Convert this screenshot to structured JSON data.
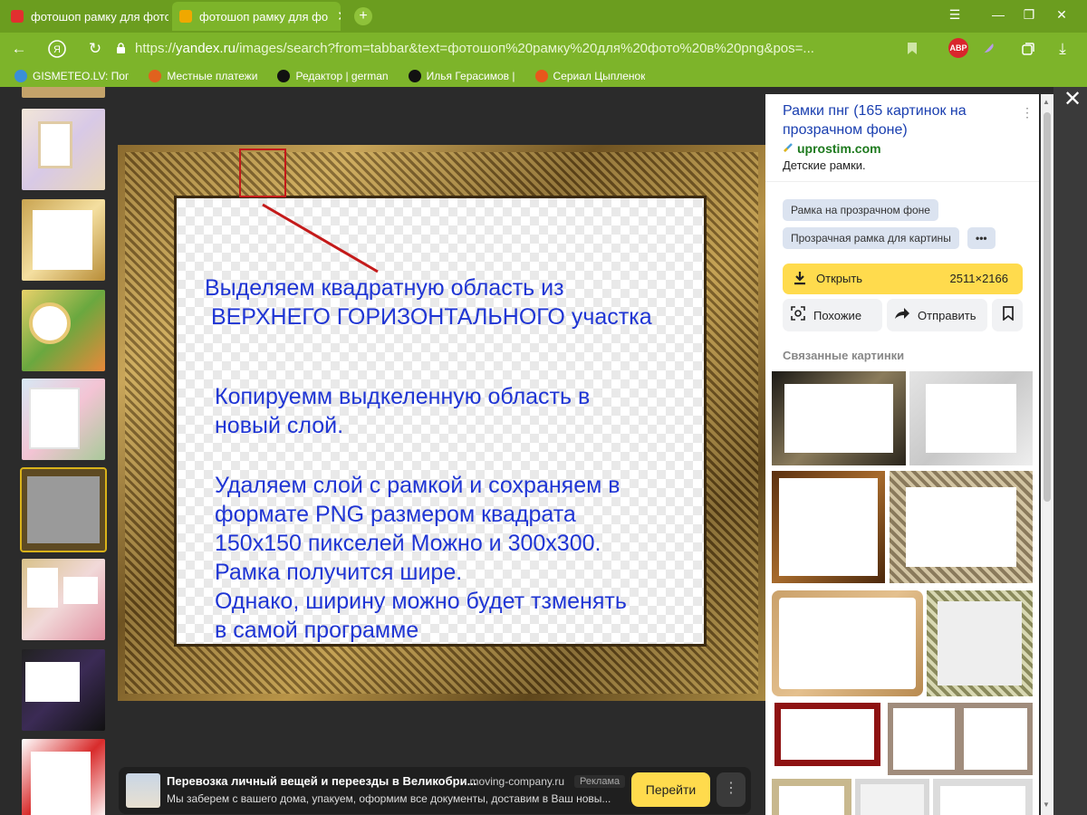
{
  "browser": {
    "tabs": [
      {
        "title": "фотошоп рамку для фото",
        "favicon_color": "#e22f2f"
      },
      {
        "title": "фотошоп рамку для фо",
        "favicon_color": "#f0a800",
        "active": true
      }
    ],
    "new_tab_label": "+",
    "window_controls": {
      "tabs_menu": "☰",
      "minimize": "—",
      "restore": "❐",
      "close": "✕"
    },
    "url_prefix": "https://",
    "url_domain": "yandex.ru",
    "url_path": "/images/search?from=tabbar&text=фотошоп%20рамку%20для%20фото%20в%20png&pos=...",
    "abp_label": "ABP",
    "bookmarks": [
      {
        "label": "GISMETEO.LV: Пог",
        "icon_color": "#3a8fd9"
      },
      {
        "label": "Местные платежи",
        "icon_color": "#e0621e"
      },
      {
        "label": "Редактор | german",
        "icon_color": "#111111"
      },
      {
        "label": "Илья Герасимов |",
        "icon_color": "#111111"
      },
      {
        "label": "Сериал Цыпленок",
        "icon_color": "#e8571c"
      }
    ],
    "accent": "#7db42a",
    "tabbar_color": "#6b9d1f"
  },
  "viewer": {
    "close_label": "✕",
    "annotations": [
      "Выделяем квадратную область из",
      " ВЕРХНЕГО ГОРИЗОНТАЛЬНОГО участка",
      "Копируемм выдкеленную  область в",
      "новый слой.",
      "Удаляем слой с рамкой и сохраняем в",
      "формате PNG размером квадрата",
      "150х150 пикселей Можно и 300х300.",
      "Рамка получится шире.",
      "Однако, ширину можно будет тзменять",
      "в самой программе"
    ],
    "annotation_color": "#1f35d4",
    "selection_color": "#c41a1a"
  },
  "ad": {
    "title": "Перевозка личный вещей и переезды в Великобри...",
    "source": "• moving-company.ru",
    "tag": "Реклама",
    "description": "Мы заберем с вашего дома, упакуем, оформим все документы, доставим в Ваш новы...",
    "go_label": "Перейти",
    "more_label": "⋮"
  },
  "panel": {
    "title": "Рамки пнг (165 картинок на прозрачном фоне)",
    "domain": "uprostim.com",
    "description": "Детские рамки.",
    "kebab": "⋮",
    "chips": [
      "Рамка на прозрачном фоне",
      "Прозрачная рамка для картины",
      "•••"
    ],
    "open_label": "Открыть",
    "open_size": "2511×2166",
    "similar_label": "Похожие",
    "share_label": "Отправить",
    "related_title": "Связанные картинки"
  }
}
